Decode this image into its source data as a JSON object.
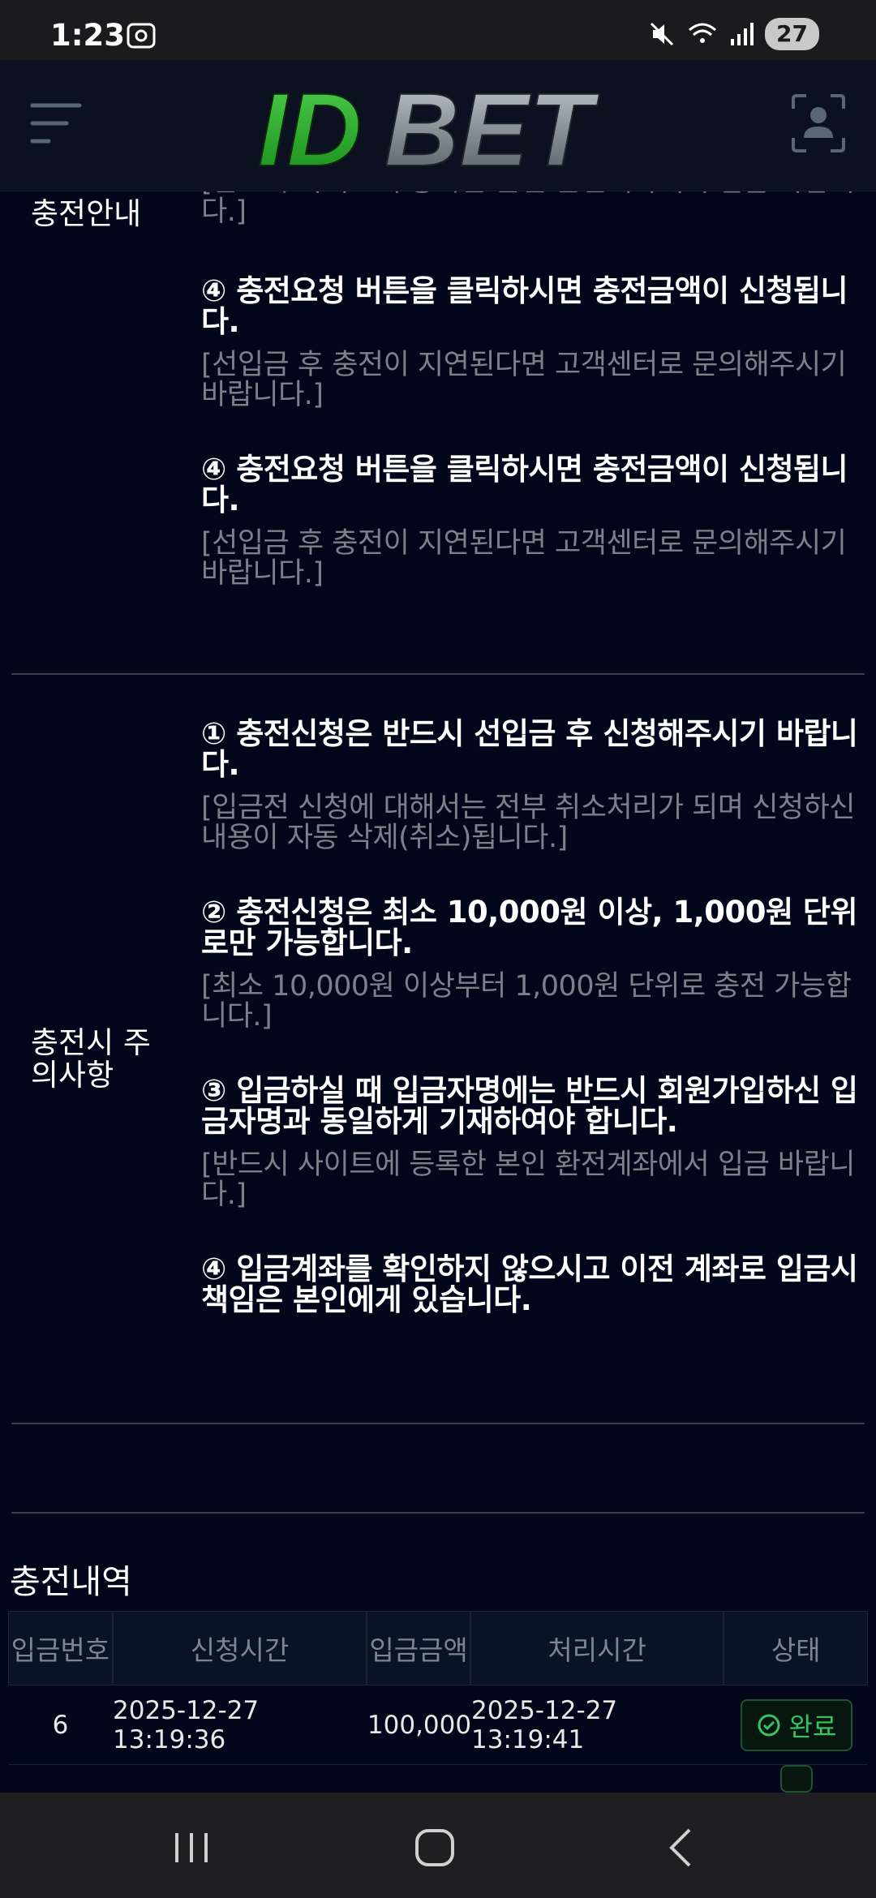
{
  "status_bar": {
    "time": "1:23",
    "battery": "27",
    "icons": [
      "screenshot-icon",
      "mute-icon",
      "wifi-icon",
      "signal-icon"
    ]
  },
  "header": {
    "logo_text": "IDBET",
    "logo_colors": {
      "id": "#2aa52a",
      "bet": "#8a9299"
    },
    "menu_icon": "hamburger-icon",
    "profile_icon": "user-profile-icon"
  },
  "guide": {
    "label": "충전안내",
    "partial_sub": "[반드시 사이트에 등록한 본인 환전계좌에서 입금 바랍니다.]",
    "items": [
      {
        "main": "④ 충전요청 버튼을 클릭하시면 충전금액이 신청됩니다.",
        "sub": "[선입금 후 충전이 지연된다면 고객센터로 문의해주시기 바랍니다.]"
      },
      {
        "main": "④ 충전요청 버튼을 클릭하시면 충전금액이 신청됩니다.",
        "sub": "[선입금 후 충전이 지연된다면 고객센터로 문의해주시기 바랍니다.]"
      }
    ]
  },
  "notice": {
    "label": "충전시 주의사항",
    "items": [
      {
        "main": "① 충전신청은 반드시 선입금 후 신청해주시기 바랍니다.",
        "sub": "[입금전 신청에 대해서는 전부 취소처리가 되며 신청하신 내용이 자동 삭제(취소)됩니다.]"
      },
      {
        "main": "② 충전신청은 최소 10,000원 이상, 1,000원 단위로만 가능합니다.",
        "sub": "[최소 10,000원 이상부터 1,000원 단위로 충전 가능합니다.]"
      },
      {
        "main": "③ 입금하실 때 입금자명에는 반드시 회원가입하신 입금자명과 동일하게 기재하여야 합니다.",
        "sub": "[반드시 사이트에 등록한 본인 환전계좌에서 입금 바랍니다.]"
      },
      {
        "main": "④ 입금계좌를 확인하지 않으시고 이전 계좌로 입금시 책임은 본인에게 있습니다.",
        "sub": ""
      }
    ]
  },
  "history": {
    "title": "충전내역",
    "columns": [
      "입금번호",
      "신청시간",
      "입금금액",
      "처리시간",
      "상태"
    ],
    "rows": [
      {
        "no": "6",
        "requested": "2025-12-27 13:19:36",
        "amount": "100,000",
        "processed": "2025-12-27 13:19:41",
        "status": "완료"
      }
    ],
    "status_color": "#35c463"
  },
  "nav": {
    "icons": [
      "recents-icon",
      "home-icon",
      "back-icon"
    ]
  }
}
